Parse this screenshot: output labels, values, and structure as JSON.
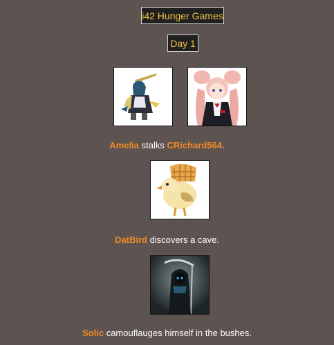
{
  "game": {
    "title": "i42 Hunger Games",
    "day_label": "Day 1"
  },
  "events": [
    {
      "tributes": [
        "Amelia",
        "CRichard564"
      ],
      "connector": " stalks ",
      "suffix": ".",
      "avatar_icons": [
        "armored-knight-avatar-icon",
        "pink-hair-girl-avatar-icon"
      ]
    },
    {
      "tributes": [
        "DatBird"
      ],
      "suffix": " discovers a cave.",
      "avatar_icons": [
        "bird-with-waffle-avatar-icon"
      ]
    },
    {
      "tributes": [
        "Solic"
      ],
      "suffix": " camouflauges himself in the bushes.",
      "avatar_icons": [
        "hooded-reaper-avatar-icon"
      ]
    }
  ],
  "colors": {
    "background": "#5d5350",
    "tribute_name": "#f08a24",
    "header_text": "#f2c340",
    "header_bg": "#202020",
    "event_text": "#ffffff"
  }
}
